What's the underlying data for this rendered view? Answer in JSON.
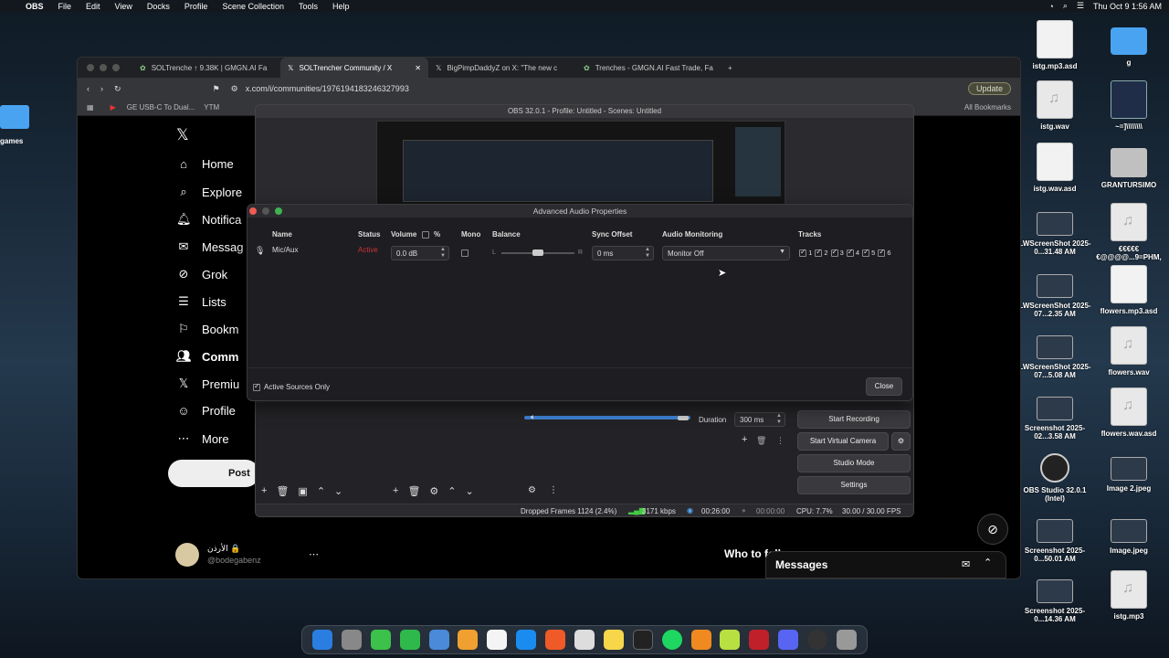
{
  "menubar": {
    "app": "OBS",
    "items": [
      "File",
      "Edit",
      "View",
      "Docks",
      "Profile",
      "Scene Collection",
      "Tools",
      "Help"
    ],
    "clock": "Thu Oct 9  1:56 AM"
  },
  "desktop": {
    "left_partial_label": "games",
    "icons": [
      {
        "label": "istg.mp3.asd",
        "kind": "doc"
      },
      {
        "label": "g",
        "kind": "folder"
      },
      {
        "label": "istg.wav",
        "kind": "audio"
      },
      {
        "label": "~=]\\\\\\\\\\\\\\\\",
        "kind": "dark"
      },
      {
        "label": "istg.wav.asd",
        "kind": "doc"
      },
      {
        "label": "GRANTURSIMO",
        "kind": "drive"
      },
      {
        "label": "LWScreenShot 2025-0...31.48 AM",
        "kind": "shot"
      },
      {
        "label": "€€€€€ €@@@@...9=PHM,",
        "kind": "audio"
      },
      {
        "label": "LWScreenShot 2025-07...2.35 AM",
        "kind": "shot"
      },
      {
        "label": "flowers.mp3.asd",
        "kind": "doc"
      },
      {
        "label": "LWScreenShot 2025-07...5.08 AM",
        "kind": "shot"
      },
      {
        "label": "flowers.wav",
        "kind": "audio"
      },
      {
        "label": "Screenshot 2025-02...3.58 AM",
        "kind": "shot"
      },
      {
        "label": "flowers.wav.asd",
        "kind": "audio"
      },
      {
        "label": "OBS Studio 32.0.1 (Intel)",
        "kind": "obs"
      },
      {
        "label": "Image 2.jpeg",
        "kind": "shot"
      },
      {
        "label": "Screenshot 2025-0...50.01 AM",
        "kind": "shot"
      },
      {
        "label": "Image.jpeg",
        "kind": "shot"
      },
      {
        "label": "Screenshot 2025-0...14.36 AM",
        "kind": "shot"
      },
      {
        "label": "istg.mp3",
        "kind": "audio"
      }
    ]
  },
  "browser": {
    "tabs": [
      {
        "title": "SOLTrenche ↑ 9.38K | GMGN.AI Fa"
      },
      {
        "title": "SOLTrencher Community / X",
        "active": true
      },
      {
        "title": "BigPimpDaddyZ on X: \"The new c"
      },
      {
        "title": "Trenches - GMGN.AI Fast Trade, Fa"
      }
    ],
    "url": "x.com/i/communities/1976194183246327993",
    "bookmarks": [
      "GE USB-C To Dual...",
      "YTM"
    ],
    "all_bookmarks": "All Bookmarks",
    "update_label": "Update"
  },
  "x": {
    "nav": [
      "Home",
      "Explore",
      "Notifica",
      "Messag",
      "Grok",
      "Lists",
      "Bookm",
      "Comm",
      "Premiu",
      "Profile",
      "More"
    ],
    "post_label": "Post",
    "user_name": "الأرذن 🔒",
    "user_handle": "@bodegabenz",
    "who_to_follow": "Who to follow",
    "messages_label": "Messages"
  },
  "obs": {
    "title": "OBS 32.0.1 - Profile: Untitled - Scenes: Untitled",
    "duration_label": "Duration",
    "duration_value": "300 ms",
    "buttons": [
      "Start Recording",
      "Start Virtual Camera",
      "Studio Mode",
      "Settings"
    ],
    "status": {
      "dropped": "Dropped Frames 1124 (2.4%)",
      "kbps": "3171 kbps",
      "rec_time": "00:26:00",
      "stream_time": "00:00:00",
      "cpu": "CPU: 7.7%",
      "fps": "30.00 / 30.00 FPS"
    }
  },
  "dialog": {
    "title": "Advanced Audio Properties",
    "headers": {
      "name": "Name",
      "status": "Status",
      "volume": "Volume",
      "percent": "%",
      "mono": "Mono",
      "balance": "Balance",
      "sync": "Sync Offset",
      "monitoring": "Audio Monitoring",
      "tracks": "Tracks"
    },
    "row": {
      "name": "Mic/Aux",
      "status": "Active",
      "volume": "0.0 dB",
      "balance_left": "L",
      "balance_right": "R",
      "balance_value": 0.5,
      "sync": "0 ms",
      "monitoring": "Monitor Off",
      "tracks": [
        "1",
        "2",
        "3",
        "4",
        "5",
        "6"
      ]
    },
    "active_only_label": "Active Sources Only",
    "close_label": "Close"
  }
}
